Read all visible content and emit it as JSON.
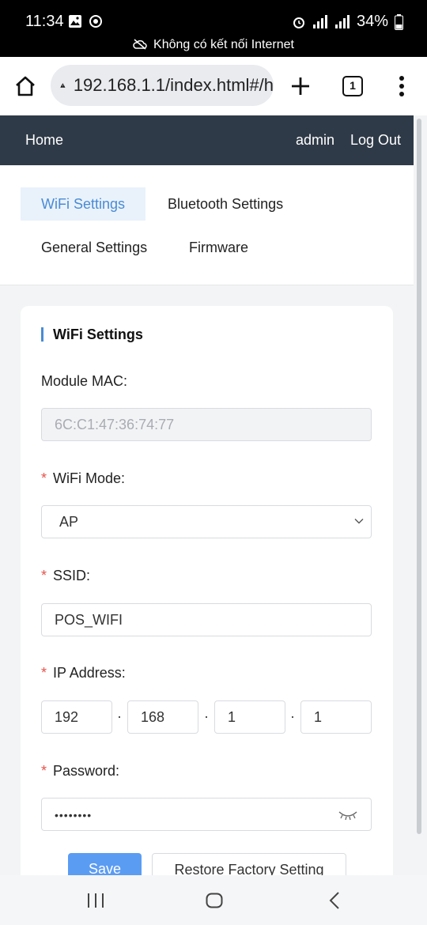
{
  "status_bar": {
    "time": "11:34",
    "battery": "34%",
    "network_message": "Không có kết nối Internet"
  },
  "browser": {
    "url": "192.168.1.1/index.html#/h",
    "tab_count": "1"
  },
  "header": {
    "home": "Home",
    "user": "admin",
    "logout": "Log Out"
  },
  "tabs": [
    {
      "label": "WiFi Settings",
      "active": true
    },
    {
      "label": "Bluetooth Settings",
      "active": false
    },
    {
      "label": "General Settings",
      "active": false
    },
    {
      "label": "Firmware",
      "active": false
    }
  ],
  "form": {
    "title": "WiFi Settings",
    "mac_label": "Module MAC:",
    "mac_value": "6C:C1:47:36:74:77",
    "mode_label": "WiFi Mode:",
    "mode_value": "AP",
    "ssid_label": "SSID:",
    "ssid_value": "POS_WIFI",
    "ip_label": "IP Address:",
    "ip_parts": [
      "192",
      "168",
      "1",
      "1"
    ],
    "password_label": "Password:",
    "password_value": "••••••••",
    "required_mark": "*",
    "ip_separator": "·",
    "save_label": "Save",
    "restore_label": "Restore Factory Setting"
  },
  "colors": {
    "header_bg": "#2f3a48",
    "accent": "#4a8bd4",
    "primary_button": "#5b9cf3",
    "required": "#e5534b"
  },
  "icons": [
    "home-icon",
    "warning-icon",
    "plus-icon",
    "tabs-icon",
    "more-icon",
    "chevron-down-icon",
    "eye-closed-icon",
    "recent-apps-icon",
    "home-nav-icon",
    "back-icon"
  ]
}
